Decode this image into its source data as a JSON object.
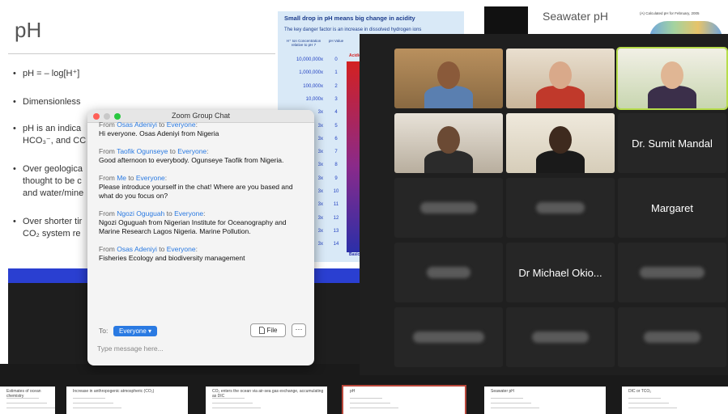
{
  "slide": {
    "title": "pH",
    "bullets": [
      "pH = – log[H⁺]",
      "Dimensionless",
      "pH is an indica",
      "HCO₃⁻, and CC",
      "Over geologica",
      "thought to be c",
      "and water/mine",
      "Over shorter tir",
      "CO₂ system re"
    ]
  },
  "acidity_panel": {
    "title": "Small drop in pH means big change in acidity",
    "subtitle": "The key danger factor is an increase in dissolved hydrogen ions",
    "col_conc": "H⁺ Ion Concentration relative to pH 7",
    "col_ph": "pH Value",
    "label_top": "Acidic",
    "label_bottom": "Basic",
    "rows": [
      {
        "conc": "10,000,000x",
        "ph": "0"
      },
      {
        "conc": "1,000,000x",
        "ph": "1"
      },
      {
        "conc": "100,000x",
        "ph": "2"
      },
      {
        "conc": "10,000x",
        "ph": "3"
      },
      {
        "conc": "3x",
        "ph": "4"
      },
      {
        "conc": "3x",
        "ph": "5"
      },
      {
        "conc": "3x",
        "ph": "6"
      },
      {
        "conc": "3x",
        "ph": "7"
      },
      {
        "conc": "3x",
        "ph": "8"
      },
      {
        "conc": "3x",
        "ph": "9"
      },
      {
        "conc": "3x",
        "ph": "10"
      },
      {
        "conc": "3x",
        "ph": "11"
      },
      {
        "conc": "3x",
        "ph": "12"
      },
      {
        "conc": "3x",
        "ph": "13"
      },
      {
        "conc": "3x",
        "ph": "14"
      }
    ]
  },
  "seawater": {
    "title": "Seawater pH",
    "caption": "(A) Calculated pH for February, 2005"
  },
  "gallery": {
    "tiles": [
      {
        "kind": "video",
        "name": ""
      },
      {
        "kind": "video",
        "name": ""
      },
      {
        "kind": "video",
        "name": "",
        "active": true
      },
      {
        "kind": "video",
        "name": ""
      },
      {
        "kind": "video",
        "name": ""
      },
      {
        "kind": "name",
        "name": "Dr. Sumit Mandal"
      },
      {
        "kind": "blur",
        "name": ""
      },
      {
        "kind": "blur",
        "name": ""
      },
      {
        "kind": "name",
        "name": "Margaret"
      },
      {
        "kind": "blur",
        "name": ""
      },
      {
        "kind": "name",
        "name": "Dr Michael Okio..."
      },
      {
        "kind": "blur",
        "name": ""
      },
      {
        "kind": "blur",
        "name": ""
      },
      {
        "kind": "blur",
        "name": ""
      },
      {
        "kind": "blur",
        "name": ""
      }
    ]
  },
  "chat": {
    "window_title": "Zoom Group Chat",
    "messages": [
      {
        "from": "Osas Adeniyi",
        "to": "Everyone",
        "text": "Hi everyone. Osas Adeniyi from Nigeria"
      },
      {
        "from": "Taofik Ogunseye",
        "to": "Everyone",
        "text": "Good afternoon to everybody. Ogunseye Taofik from Nigeria."
      },
      {
        "from": "Me",
        "to": "Everyone",
        "text": "Please introduce yourself in the chat! Where are you based and what do you focus on?"
      },
      {
        "from": "Ngozi Oguguah",
        "to": "Everyone",
        "text": "Ngozi Oguguah from Nigerian Institute for Oceanography and Marine Research Lagos Nigeria. Marine Pollution."
      },
      {
        "from": "Osas Adeniyi",
        "to": "Everyone",
        "text": "Fisheries Ecology and biodiversity management"
      }
    ],
    "from_label": "From",
    "to_word": "to",
    "to_label": "To:",
    "recipient": "Everyone",
    "file_label": "File",
    "more_label": "···",
    "placeholder": "Type message here..."
  },
  "thumbnails": [
    {
      "title": "Estimates of ocean chemistry"
    },
    {
      "title": "Increase in anthropogenic atmospheric (CO₂)"
    },
    {
      "title": "CO₂ enters the ocean via air-sea gas exchange, accumulating as DIC"
    },
    {
      "title": "pH",
      "active": true
    },
    {
      "title": "Seawater pH"
    },
    {
      "title": "DIC or TCO₂"
    }
  ],
  "colors": {
    "chat_link": "#2a7ae2",
    "active_speaker": "#b7dd4b",
    "slide_band": "#2a3fd1"
  }
}
